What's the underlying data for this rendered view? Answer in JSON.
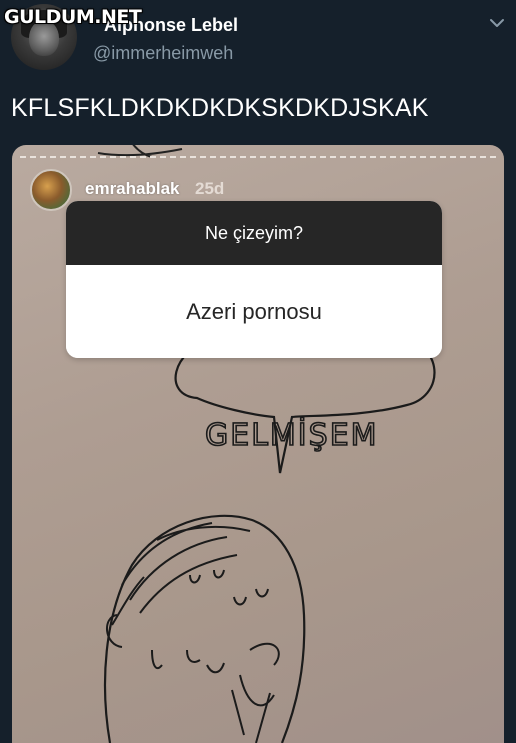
{
  "watermark": "GULDUM.NET",
  "tweet": {
    "display_name": "Alphonse Lebel",
    "handle": "@immerheimweh",
    "text": "KFLSFKLDKDKDKDKSKDKDJSKAK"
  },
  "story": {
    "username": "emrahablak",
    "age": "25d",
    "question_title": "Ne çizeyim?",
    "answer": "Azeri pornosu",
    "drawing_text": "GELMİŞEM"
  },
  "icons": {
    "menu": "chevron-down-icon"
  },
  "colors": {
    "background": "#15202b",
    "secondary_text": "#8899a6",
    "paper": "#ae9d92",
    "question_header": "#262626"
  }
}
